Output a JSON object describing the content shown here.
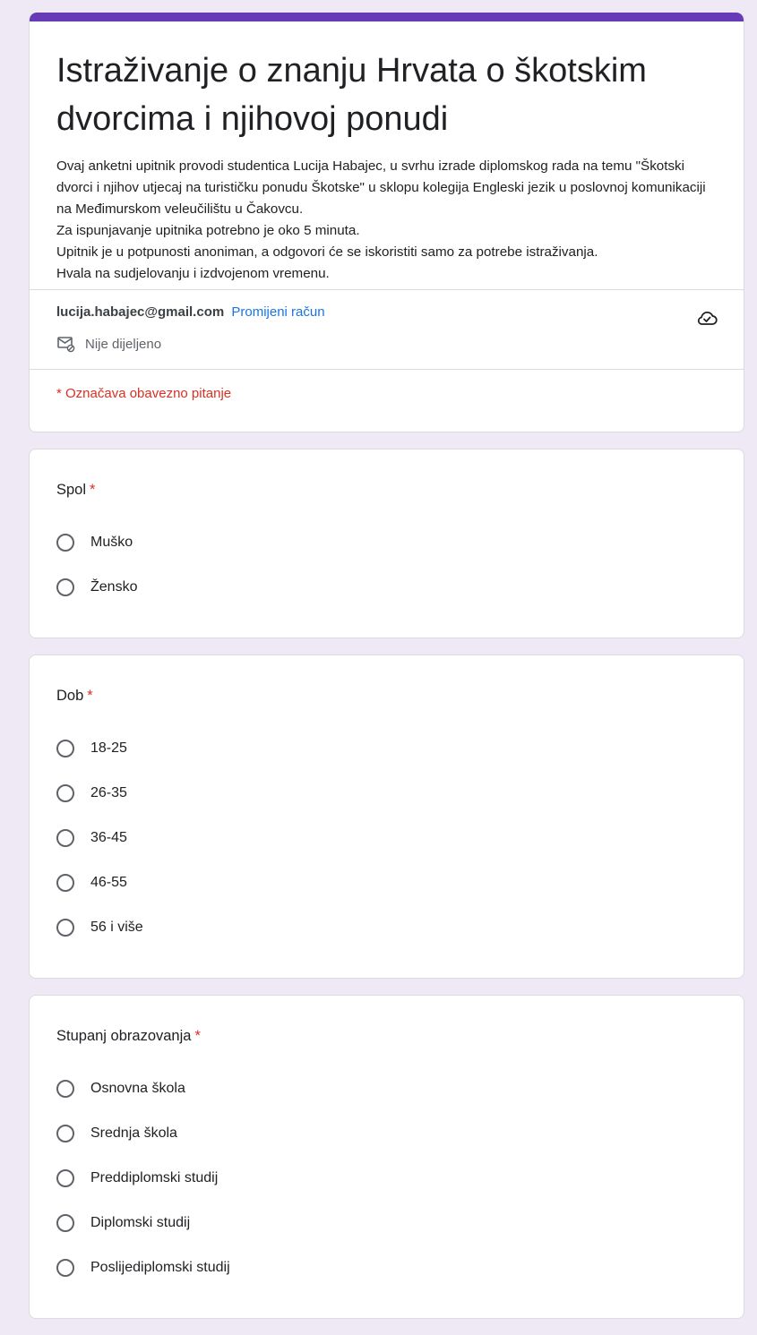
{
  "form": {
    "title": "Istraživanje o znanju Hrvata o škotskim dvorcima i njihovoj ponudi",
    "description": [
      "Ovaj anketni upitnik provodi studentica Lucija Habajec, u svrhu izrade diplomskog rada na temu \"Škotski dvorci i njihov utjecaj na turističku ponudu Škotske\" u sklopu kolegija Engleski jezik u poslovnoj komunikaciji na Međimurskom veleučilištu u Čakovcu.",
      "Za ispunjavanje upitnika potrebno je oko 5 minuta.",
      "Upitnik je u potpunosti anoniman, a odgovori će se iskoristiti samo za potrebe istraživanja.",
      "Hvala na sudjelovanju i izdvojenom vremenu."
    ],
    "accent_color": "#673ab7"
  },
  "account": {
    "email": "lucija.habajec@gmail.com",
    "switch_label": "Promijeni račun",
    "shared_status": "Nije dijeljeno",
    "shared_icon": "mail-not-shared-icon",
    "cloud_icon": "cloud-save-icon"
  },
  "required_note": "* Označava obavezno pitanje",
  "questions": [
    {
      "label": "Spol",
      "required": "*",
      "options": [
        "Muško",
        "Žensko"
      ]
    },
    {
      "label": "Dob",
      "required": "*",
      "options": [
        "18-25",
        "26-35",
        "36-45",
        "46-55",
        "56 i više"
      ]
    },
    {
      "label": "Stupanj obrazovanja",
      "required": "*",
      "options": [
        "Osnovna škola",
        "Srednja škola",
        "Preddiplomski studij",
        "Diplomski studij",
        "Poslijediplomski studij"
      ]
    }
  ]
}
